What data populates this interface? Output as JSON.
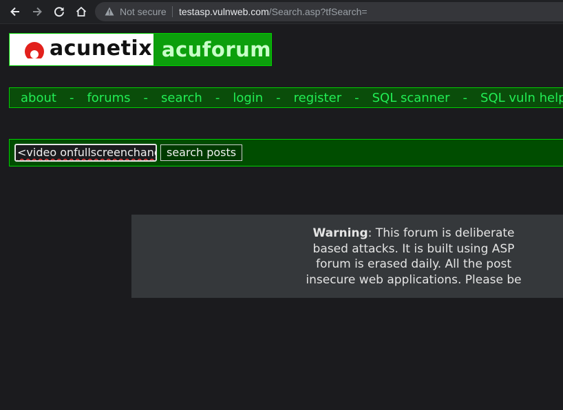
{
  "browser": {
    "security_label": "Not secure",
    "url_host": "testasp.vulnweb.com",
    "url_path": "/Search.asp?tfSearch="
  },
  "logo": {
    "brand": "acunetix",
    "product": "acuforum"
  },
  "nav": {
    "items": [
      "about",
      "forums",
      "search",
      "login",
      "register",
      "SQL scanner",
      "SQL vuln help"
    ],
    "separator": "-"
  },
  "search": {
    "input_value": "<video onfullscreenchang",
    "button_label": "search posts"
  },
  "warning": {
    "label": "Warning",
    "line1": ": This forum is deliberate",
    "line2": "based attacks. It is built using ASP",
    "line3": "forum is erased daily. All the post",
    "line4": "insecure web applications. Please be"
  },
  "colors": {
    "page_bg": "#1b1b1e",
    "nav_text": "#22ee55",
    "border_green": "#00d000"
  }
}
